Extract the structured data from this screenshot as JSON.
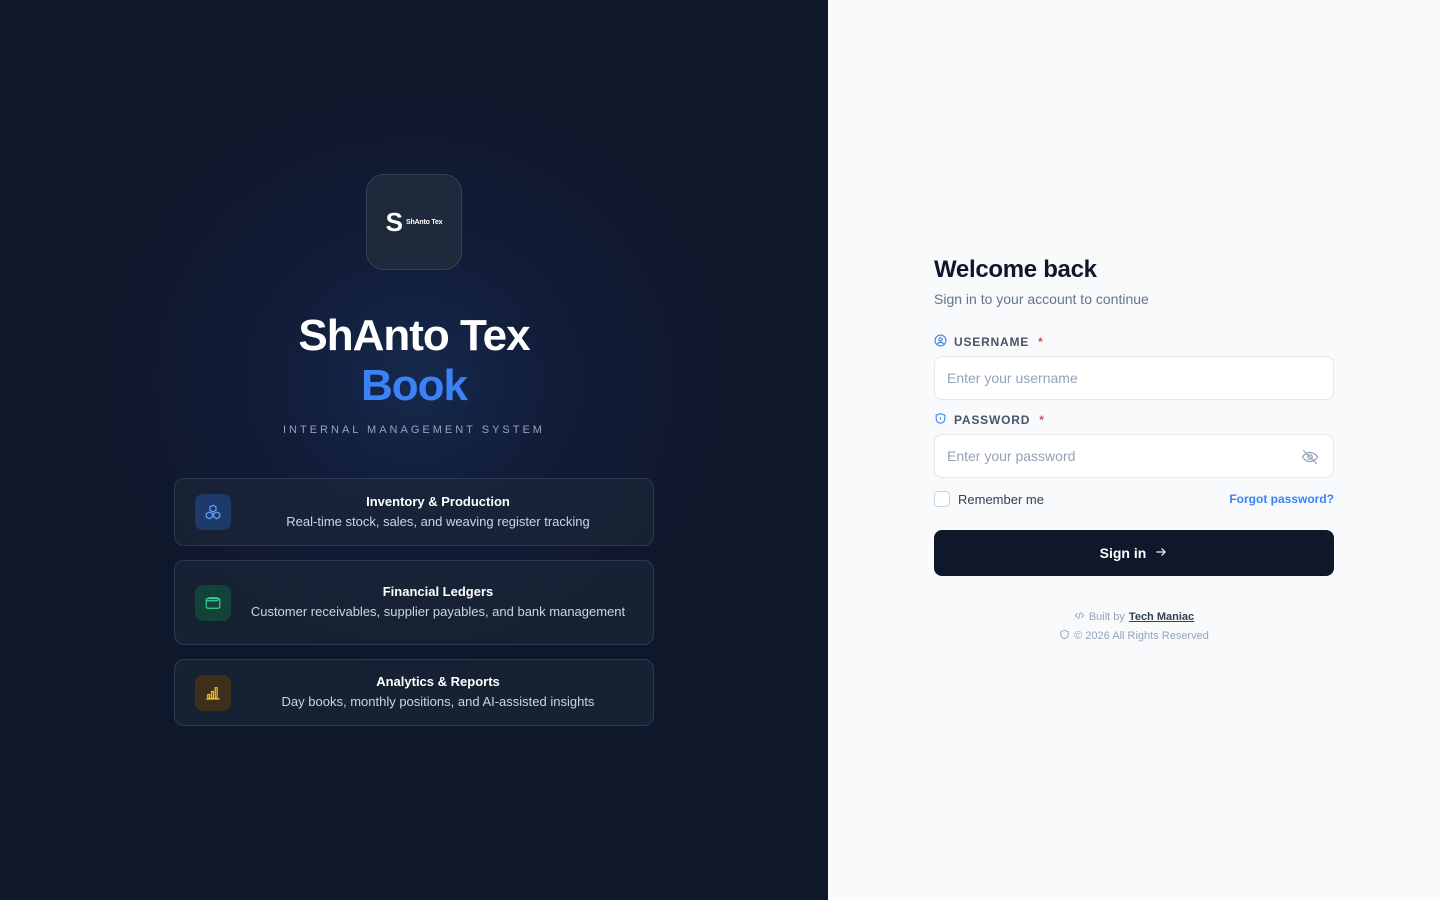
{
  "brand": {
    "logo_letter": "S",
    "logo_text": "ShAnto Tex",
    "title": "ShAnto Tex",
    "subtitle": "Book",
    "tagline": "INTERNAL MANAGEMENT SYSTEM"
  },
  "features": [
    {
      "icon": "cubes-icon",
      "title": "Inventory & Production",
      "description": "Real-time stock, sales, and weaving register tracking",
      "color": "#3b82f6"
    },
    {
      "icon": "wallet-icon",
      "title": "Financial Ledgers",
      "description": "Customer receivables, supplier payables, and bank management",
      "color": "#10b981"
    },
    {
      "icon": "bar-chart-icon",
      "title": "Analytics & Reports",
      "description": "Day books, monthly positions, and AI-assisted insights",
      "color": "#f59e0b"
    }
  ],
  "login": {
    "title": "Welcome back",
    "subtitle": "Sign in to your account to continue",
    "username_label": "USERNAME",
    "username_placeholder": "Enter your username",
    "username_value": "",
    "password_label": "PASSWORD",
    "password_placeholder": "Enter your password",
    "password_value": "",
    "required_marker": "*",
    "remember_label": "Remember me",
    "remember_checked": false,
    "forgot_label": "Forgot password?",
    "signin_label": "Sign in"
  },
  "footer": {
    "built_by_prefix": "Built by",
    "built_by_name": "Tech Maniac",
    "copyright": "© 2026 All Rights Reserved"
  },
  "colors": {
    "accent": "#3b82f6",
    "dark": "#0f172a",
    "required": "#ef4444"
  }
}
